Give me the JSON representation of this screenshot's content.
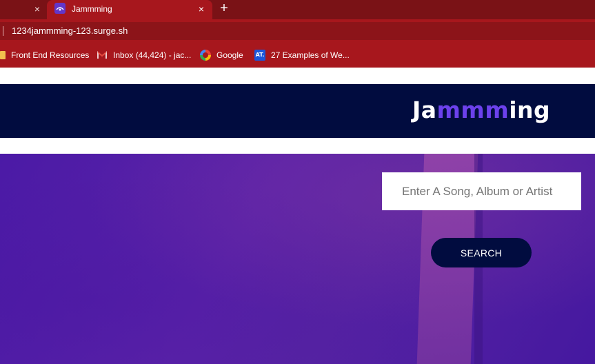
{
  "browser": {
    "tabs": [
      {
        "title": "",
        "active": false
      },
      {
        "title": "Jammming",
        "active": true
      }
    ],
    "close_glyph": "×",
    "newtab_glyph": "+",
    "url": "1234jammming-123.surge.sh",
    "bookmarks": [
      {
        "label": "Front End Resources",
        "icon": "folder-icon"
      },
      {
        "label": "Inbox (44,424) - jac...",
        "icon": "gmail-icon"
      },
      {
        "label": "Google",
        "icon": "google-icon"
      },
      {
        "label": "27 Examples of We...",
        "icon": "at-icon",
        "icon_text": "AT."
      }
    ],
    "theme_colors": {
      "tabstrip": "#7a1216",
      "toolbar": "#a7171d"
    }
  },
  "app": {
    "logo": {
      "part1": "Ja",
      "part2": "mmm",
      "part3": "ing"
    },
    "brand_colors": {
      "header": "#010c3f",
      "accent": "#6c41ec",
      "hero": "#4b1aa6"
    },
    "search": {
      "placeholder": "Enter A Song, Album or Artist",
      "value": "",
      "button_label": "SEARCH"
    }
  }
}
